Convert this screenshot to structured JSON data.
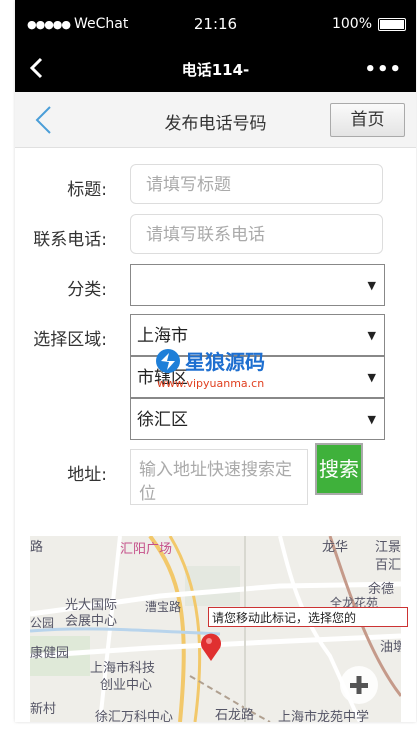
{
  "status_bar": {
    "carrier": "WeChat",
    "time": "21:16",
    "battery": "100%"
  },
  "nav_bar": {
    "title": "电话114-"
  },
  "header": {
    "title": "发布电话号码",
    "home_button": "首页"
  },
  "form": {
    "title_label": "标题:",
    "title_placeholder": "请填写标题",
    "phone_label": "联系电话:",
    "phone_placeholder": "请填写联系电话",
    "category_label": "分类:",
    "category_value": "",
    "region_label": "选择区域:",
    "province_value": "上海市",
    "city_value": "市辖区",
    "district_value": "徐汇区",
    "address_label": "地址:",
    "address_placeholder": "输入地址快速搜索定位",
    "search_button": "搜索"
  },
  "map": {
    "labels": [
      "路",
      "汇阳广场",
      "龙华",
      "江景",
      "百汇",
      "光大国际",
      "漕宝路",
      "余德",
      "会展中心",
      "公园",
      "康健园",
      "上海市科技",
      "创业中心",
      "新村",
      "徐汇万科中心",
      "石龙路",
      "上海市龙苑中学",
      "全龙花苑",
      "油墩"
    ],
    "tooltip": "请您移动此标记，选择您的"
  },
  "watermark": {
    "text": "星狼源码",
    "url": "www.vipyuanma.cn"
  },
  "colors": {
    "accent_green": "#3fb13b",
    "back_blue": "#4a9ed8",
    "marker_red": "#e03030"
  }
}
